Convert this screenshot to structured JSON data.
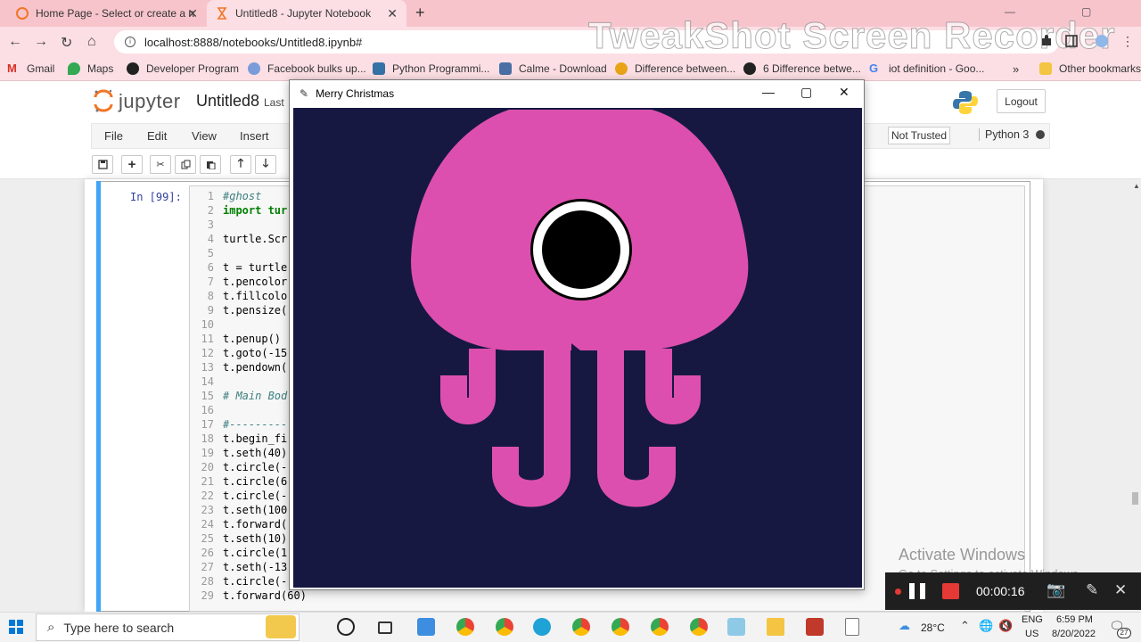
{
  "browser": {
    "tabs": [
      {
        "title": "Home Page - Select or create a n",
        "close": "✕"
      },
      {
        "title": "Untitled8 - Jupyter Notebook",
        "close": "✕"
      }
    ],
    "new_tab": "+",
    "window_controls": {
      "minimize": "—",
      "maximize": "▢",
      "close": "✕"
    },
    "url": "localhost:8888/notebooks/Untitled8.ipynb#",
    "watermark": "TweakShot Screen Recorder",
    "bookmarks": [
      {
        "label": "Gmail",
        "color": "#d93025"
      },
      {
        "label": "Maps",
        "color": "#34a853"
      },
      {
        "label": "Developer Program",
        "color": "#222222"
      },
      {
        "label": "Facebook bulks up...",
        "color": "#7a9cd8"
      },
      {
        "label": "Python Programmi...",
        "color": "#3572a5"
      },
      {
        "label": "Calme - Download",
        "color": "#4a6fa5"
      },
      {
        "label": "Difference between...",
        "color": "#e8a317"
      },
      {
        "label": "6 Difference betwe...",
        "color": "#222222"
      },
      {
        "label": "iot definition - Goo...",
        "color": "#4285f4"
      }
    ],
    "bookmarks_more": "»",
    "other_bookmarks": "Other bookmarks"
  },
  "jupyter": {
    "brand": "jupyter",
    "notebook_title": "Untitled8",
    "last_checkpoint": "Last",
    "logout": "Logout",
    "menu": [
      "File",
      "Edit",
      "View",
      "Insert"
    ],
    "trust": "Not Trusted",
    "kernel": "Python 3",
    "toolbar_icons": [
      "save-icon",
      "plus-icon",
      "cut-icon",
      "copy-icon",
      "paste-icon",
      "arrow-up-icon",
      "arrow-down-icon"
    ],
    "cell_prompt": "In [99]:",
    "code_lines": [
      {
        "n": "1",
        "text": "#ghost",
        "style": "cmt"
      },
      {
        "n": "2",
        "text": "import tur",
        "style": "kw"
      },
      {
        "n": "3",
        "text": "",
        "style": "txt"
      },
      {
        "n": "4",
        "text": "turtle.Scr",
        "style": "txt"
      },
      {
        "n": "5",
        "text": "",
        "style": "txt"
      },
      {
        "n": "6",
        "text": "t = turtle",
        "style": "txt"
      },
      {
        "n": "7",
        "text": "t.pencolor",
        "style": "txt"
      },
      {
        "n": "8",
        "text": "t.fillcolo",
        "style": "txt"
      },
      {
        "n": "9",
        "text": "t.pensize(",
        "style": "txt"
      },
      {
        "n": "10",
        "text": "",
        "style": "txt"
      },
      {
        "n": "11",
        "text": "t.penup()",
        "style": "txt"
      },
      {
        "n": "12",
        "text": "t.goto(-15",
        "style": "txt"
      },
      {
        "n": "13",
        "text": "t.pendown(",
        "style": "txt"
      },
      {
        "n": "14",
        "text": "",
        "style": "txt"
      },
      {
        "n": "15",
        "text": "# Main Bod",
        "style": "cmt"
      },
      {
        "n": "16",
        "text": "",
        "style": "txt"
      },
      {
        "n": "17",
        "text": "#---------",
        "style": "cmt"
      },
      {
        "n": "18",
        "text": "t.begin_fi",
        "style": "txt"
      },
      {
        "n": "19",
        "text": "t.seth(40)",
        "style": "txt"
      },
      {
        "n": "20",
        "text": "t.circle(-",
        "style": "txt"
      },
      {
        "n": "21",
        "text": "t.circle(6",
        "style": "txt"
      },
      {
        "n": "22",
        "text": "t.circle(-",
        "style": "txt"
      },
      {
        "n": "23",
        "text": "t.seth(100",
        "style": "txt"
      },
      {
        "n": "24",
        "text": "t.forward(",
        "style": "txt"
      },
      {
        "n": "25",
        "text": "t.seth(10)",
        "style": "txt"
      },
      {
        "n": "26",
        "text": "t.circle(1",
        "style": "txt"
      },
      {
        "n": "27",
        "text": "t.seth(-13",
        "style": "txt"
      },
      {
        "n": "28",
        "text": "t.circle(-",
        "style": "txt"
      },
      {
        "n": "29",
        "text": "t.forward(60)",
        "style": "txt"
      }
    ]
  },
  "turtle_window": {
    "title": "Merry Christmas",
    "controls": {
      "minimize": "—",
      "maximize": "▢",
      "close": "✕"
    },
    "background": "#161841",
    "creature_color": "#dd4fae"
  },
  "overlay": {
    "activate_title": "Activate Windows",
    "activate_sub": "Go to Settings to activate Windows."
  },
  "recorder": {
    "time": "00:00:16",
    "stop_color": "#e53935"
  },
  "taskbar": {
    "search_placeholder": "Type here to search",
    "temperature": "28°C",
    "lang_line1": "ENG",
    "lang_line2": "US",
    "time": "6:59 PM",
    "date": "8/20/2022",
    "notifications": "27"
  }
}
